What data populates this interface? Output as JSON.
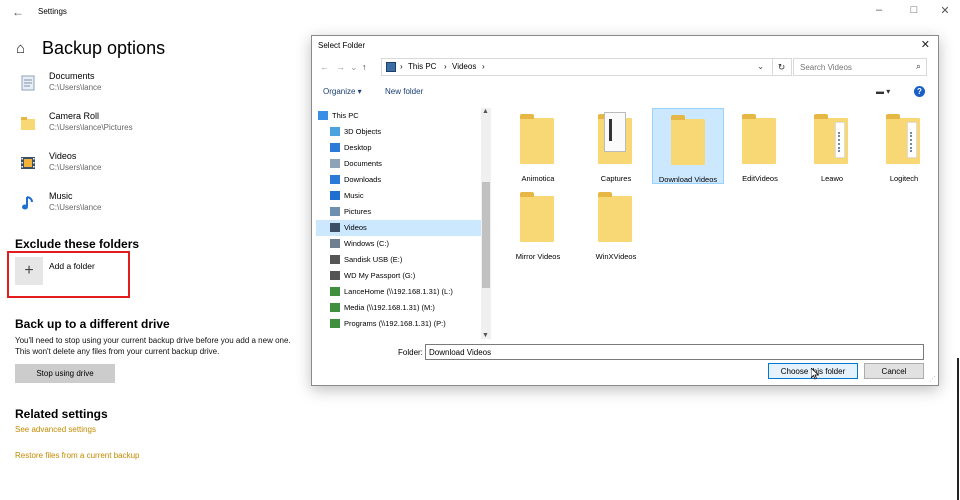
{
  "window": {
    "title": "Settings",
    "back_glyph": "←",
    "min_glyph": "–",
    "max_glyph": "□",
    "close_glyph": "✕"
  },
  "page": {
    "home_glyph": "⌂",
    "title": "Backup options"
  },
  "backup_folders": [
    {
      "name": "Documents",
      "path": "C:\\Users\\lance",
      "icon": "documents-icon"
    },
    {
      "name": "Camera Roll",
      "path": "C:\\Users\\lance\\Pictures",
      "icon": "folder-icon"
    },
    {
      "name": "Videos",
      "path": "C:\\Users\\lance",
      "icon": "videos-icon"
    },
    {
      "name": "Music",
      "path": "C:\\Users\\lance",
      "icon": "music-icon"
    }
  ],
  "exclude": {
    "heading": "Exclude these folders",
    "add_glyph": "+",
    "add_label": "Add a folder"
  },
  "different_drive": {
    "heading": "Back up to a different drive",
    "description": "You'll need to stop using your current backup drive before you add a new one. This won't delete any files from your current backup drive.",
    "stop_button": "Stop using drive"
  },
  "related": {
    "heading": "Related settings",
    "advanced_link": "See advanced settings",
    "restore_link": "Restore files from a current backup"
  },
  "dialog": {
    "title": "Select Folder",
    "close_glyph": "✕",
    "nav_back": "←",
    "nav_forward": "→",
    "nav_recent": "⌄",
    "nav_up": "↑",
    "breadcrumb": [
      "This PC",
      "Videos"
    ],
    "crumb_sep": "›",
    "dropdown_glyph": "⌄",
    "refresh_glyph": "↻",
    "search_placeholder": "Search Videos",
    "search_glyph": "⌕",
    "organize": "Organize ▾",
    "new_folder": "New folder",
    "view_glyph": "▬ ▾",
    "help_glyph": "?",
    "nav_items": [
      {
        "label": "This PC",
        "icon": "computer-icon",
        "color": "#3a8ee6",
        "indent": 0,
        "selected": false
      },
      {
        "label": "3D Objects",
        "icon": "3d-objects-icon",
        "color": "#4aa3df",
        "indent": 1,
        "selected": false
      },
      {
        "label": "Desktop",
        "icon": "desktop-icon",
        "color": "#2b7bd6",
        "indent": 1,
        "selected": false
      },
      {
        "label": "Documents",
        "icon": "documents-icon",
        "color": "#8fa3b8",
        "indent": 1,
        "selected": false
      },
      {
        "label": "Downloads",
        "icon": "downloads-icon",
        "color": "#2b7bd6",
        "indent": 1,
        "selected": false
      },
      {
        "label": "Music",
        "icon": "music-icon",
        "color": "#1f6fd1",
        "indent": 1,
        "selected": false
      },
      {
        "label": "Pictures",
        "icon": "pictures-icon",
        "color": "#6f8fb0",
        "indent": 1,
        "selected": false
      },
      {
        "label": "Videos",
        "icon": "videos-icon",
        "color": "#3d4f66",
        "indent": 1,
        "selected": true
      },
      {
        "label": "Windows (C:)",
        "icon": "drive-icon",
        "color": "#6f7f90",
        "indent": 1,
        "selected": false
      },
      {
        "label": "Sandisk USB (E:)",
        "icon": "drive-icon",
        "color": "#555555",
        "indent": 1,
        "selected": false
      },
      {
        "label": "WD My Passport (G:)",
        "icon": "drive-icon",
        "color": "#555555",
        "indent": 1,
        "selected": false
      },
      {
        "label": "LanceHome (\\\\192.168.1.31) (L:)",
        "icon": "network-drive-icon",
        "color": "#3f8f3f",
        "indent": 1,
        "selected": false
      },
      {
        "label": "Media (\\\\192.168.1.31) (M:)",
        "icon": "network-drive-icon",
        "color": "#3f8f3f",
        "indent": 1,
        "selected": false
      },
      {
        "label": "Programs (\\\\192.168.1.31) (P:)",
        "icon": "network-drive-icon",
        "color": "#3f8f3f",
        "indent": 1,
        "selected": false
      }
    ],
    "nav_scroll_up": "▲",
    "nav_scroll_down": "▼",
    "folders": [
      {
        "label": "Animotica",
        "kind": "plain",
        "selected": false
      },
      {
        "label": "Captures",
        "kind": "doc",
        "selected": false
      },
      {
        "label": "Download Videos",
        "kind": "plain",
        "selected": true
      },
      {
        "label": "EditVideos",
        "kind": "plain",
        "selected": false
      },
      {
        "label": "Leawo",
        "kind": "files",
        "selected": false
      },
      {
        "label": "Logitech",
        "kind": "files",
        "selected": false
      },
      {
        "label": "Mirror Videos",
        "kind": "plain",
        "selected": false
      },
      {
        "label": "WinXVideos",
        "kind": "plain",
        "selected": false
      }
    ],
    "folder_label": "Folder:",
    "folder_value": "Download Videos",
    "choose_button": "Choose this folder",
    "cancel_button": "Cancel",
    "grip_glyph": "⋰"
  },
  "colors": {
    "highlight_border": "#e11d1d",
    "link": "#c48a00",
    "selection": "#cce8ff",
    "folder": "#f8d775"
  }
}
